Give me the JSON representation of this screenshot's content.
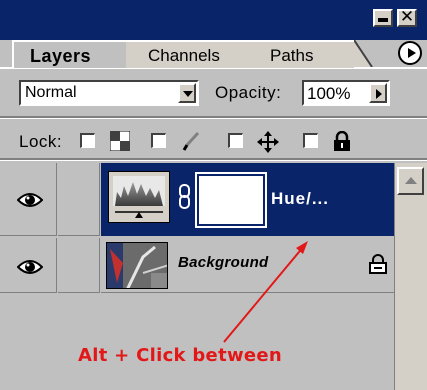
{
  "tabs": [
    {
      "label": "Layers",
      "active": true
    },
    {
      "label": "Channels",
      "active": false
    },
    {
      "label": "Paths",
      "active": false
    }
  ],
  "window_buttons": {
    "close_glyph": "✕"
  },
  "options": {
    "blend_mode": "Normal",
    "opacity_label": "Opacity:",
    "opacity_value": "100%",
    "lock_label": "Lock:"
  },
  "lock_icons": [
    "lock-transparency-icon",
    "lock-paint-brush-icon",
    "lock-move-icon",
    "lock-all-padlock-icon"
  ],
  "layers": [
    {
      "name": "Hue/...",
      "selected": true,
      "visible": true,
      "type": "adjustment"
    },
    {
      "name": "Background",
      "selected": false,
      "visible": true,
      "type": "image",
      "locked": true
    }
  ],
  "annotation": {
    "text": "Alt + Click between"
  },
  "colors": {
    "selection": "#0a246a",
    "panel": "#c0c0c0",
    "annotation": "#e21818"
  }
}
